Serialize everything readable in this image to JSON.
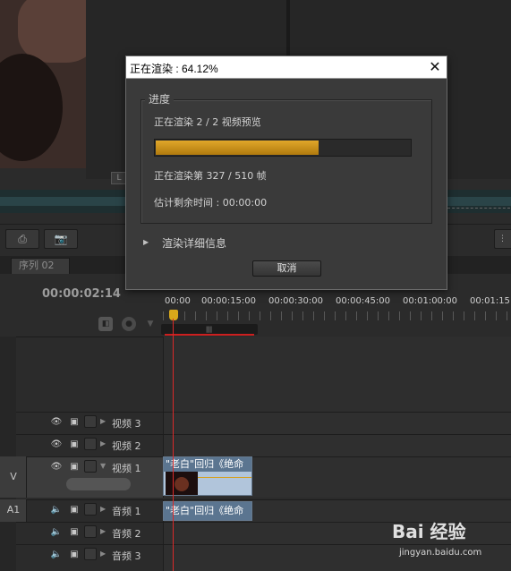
{
  "dialog": {
    "title": "正在渲染 : 64.12%",
    "group_label": "进度",
    "rendering_line": "正在渲染 2 / 2 视频预览",
    "progress_fraction": 0.6412,
    "frame_line": "正在渲染第 327 / 510 帧",
    "remaining_line": "估计剩余时间 : 00:00:00",
    "details_label": "渲染详细信息",
    "cancel_label": "取消"
  },
  "timeline": {
    "tab_label": "序列 02",
    "timecode": "00:00:02:14",
    "ruler_labels": [
      "00:00",
      "00:00:15:00",
      "00:00:30:00",
      "00:00:45:00",
      "00:01:00:00",
      "00:01:15"
    ],
    "video_tracks": [
      {
        "label": "视频 3"
      },
      {
        "label": "视频 2"
      },
      {
        "label": "视频 1",
        "key": "V"
      }
    ],
    "audio_tracks": [
      {
        "label": "音频 1",
        "key": "A1"
      },
      {
        "label": "音频 2"
      },
      {
        "label": "音频 3"
      }
    ],
    "video_clip_title": "\"老白\"回归《绝命",
    "audio_clip_title": "\"老白\"回归《绝命"
  },
  "monitor": {
    "badge": "L"
  },
  "watermark": {
    "brand": "Bai 经验",
    "url": "jingyan.baidu.com"
  },
  "colors": {
    "progress_fill": "#c48b12",
    "playhead": "#d92a2a",
    "clip_header": "#5b7590"
  }
}
